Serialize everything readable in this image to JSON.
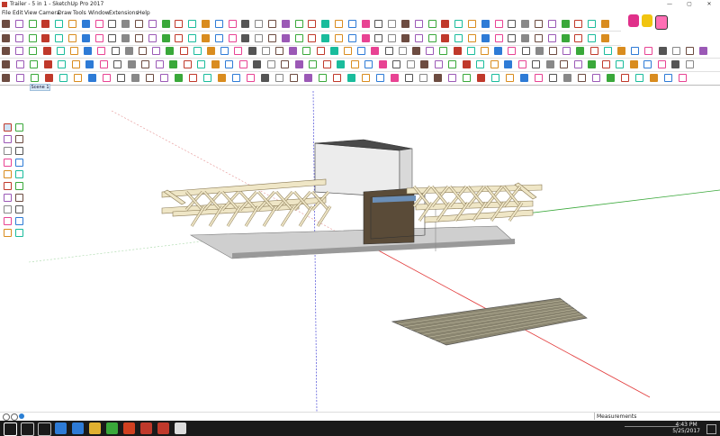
{
  "window": {
    "title": "Trailer - 5 in 1 - SketchUp Pro 2017"
  },
  "menu": [
    "File",
    "Edit",
    "View",
    "Camera",
    "Draw",
    "Tools",
    "Window",
    "Extensions",
    "Help"
  ],
  "scene_tab": "Scene 1",
  "status": {
    "measurements_label": "Measurements"
  },
  "clock": {
    "time": "4:43 PM",
    "date": "5/25/2017"
  },
  "colors": {
    "red_axis": "#e23b3b",
    "green_axis": "#3aa83a",
    "blue_axis": "#4a4ad6",
    "trailer_frame": "#efe6c6",
    "deck": "#8a8570",
    "taskbar": "#1a1a1a"
  },
  "icons": {
    "taskbar": [
      "windows-start-icon",
      "search-icon",
      "task-view-icon",
      "onedrive-icon",
      "edge-icon",
      "file-explorer-icon",
      "chrome-icon",
      "office-icon",
      "mcafee-icon",
      "sketchup-icon",
      "obs-icon"
    ],
    "left_tools": [
      "select-icon",
      "eraser-icon",
      "paint-bucket-icon",
      "line-icon",
      "freehand-icon",
      "arc-icon",
      "rectangle-icon",
      "circle-icon",
      "push-pull-icon",
      "move-icon",
      "rotate-icon",
      "scale-icon",
      "offset-icon",
      "tape-measure-icon",
      "text-icon",
      "orbit-icon",
      "pan-icon",
      "zoom-icon",
      "walk-icon",
      "section-icon"
    ]
  }
}
